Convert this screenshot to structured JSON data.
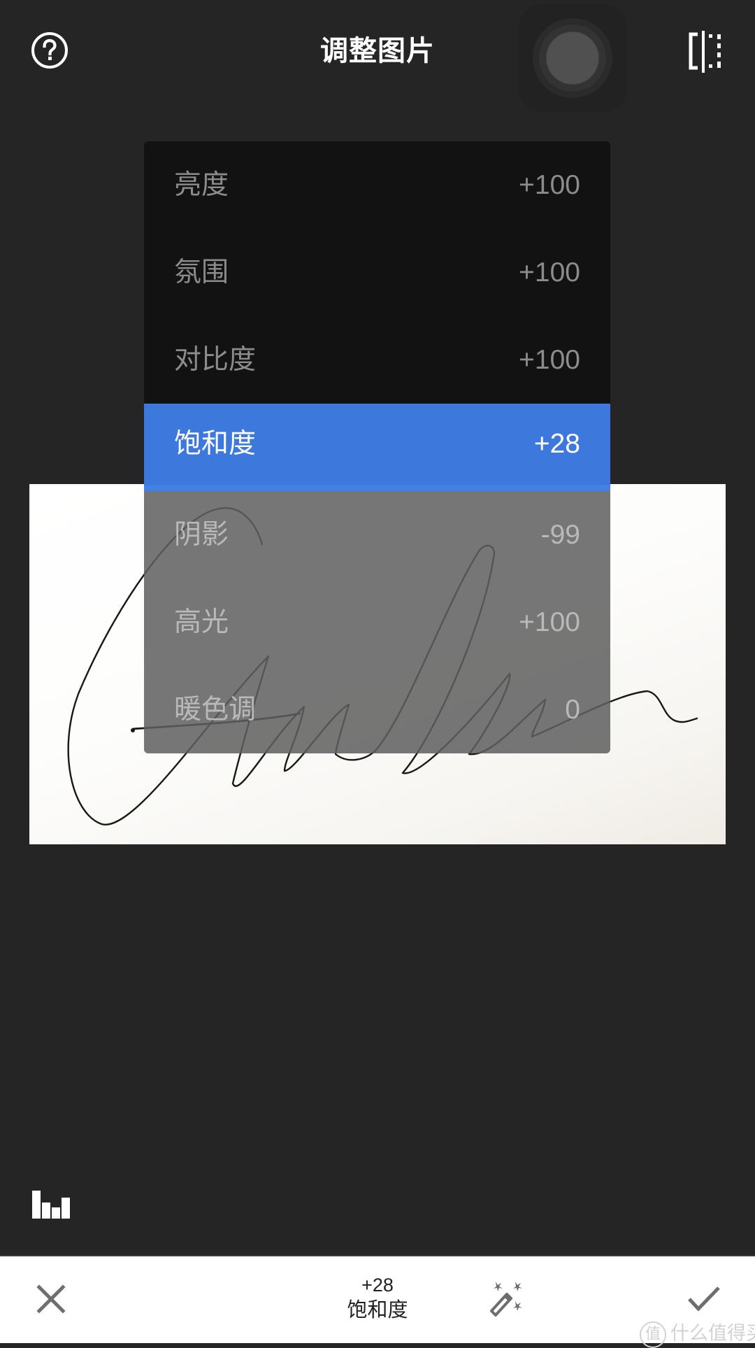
{
  "header": {
    "title": "调整图片",
    "help_icon": "help-circle-icon",
    "compare_icon": "compare-split-icon",
    "assistive_button_icon": "assistive-touch-icon"
  },
  "menu": {
    "items": [
      {
        "label": "亮度",
        "value": "+100",
        "state": "above"
      },
      {
        "label": "氛围",
        "value": "+100",
        "state": "above"
      },
      {
        "label": "对比度",
        "value": "+100",
        "state": "above"
      },
      {
        "label": "饱和度",
        "value": "+28",
        "state": "selected"
      },
      {
        "label": "阴影",
        "value": "-99",
        "state": "below"
      },
      {
        "label": "高光",
        "value": "+100",
        "state": "below"
      },
      {
        "label": "暖色调",
        "value": "0",
        "state": "below"
      }
    ],
    "selected_color": "#3d78dc"
  },
  "photo": {
    "description": "handwritten signature on white paper"
  },
  "toolbar": {
    "histogram_icon": "histogram-icon",
    "cancel_icon": "close-icon",
    "current_value": "+28",
    "current_param": "饱和度",
    "auto_icon": "magic-wand-icon",
    "apply_icon": "checkmark-icon"
  },
  "watermark": {
    "badge": "值",
    "text": "什么值得买"
  }
}
